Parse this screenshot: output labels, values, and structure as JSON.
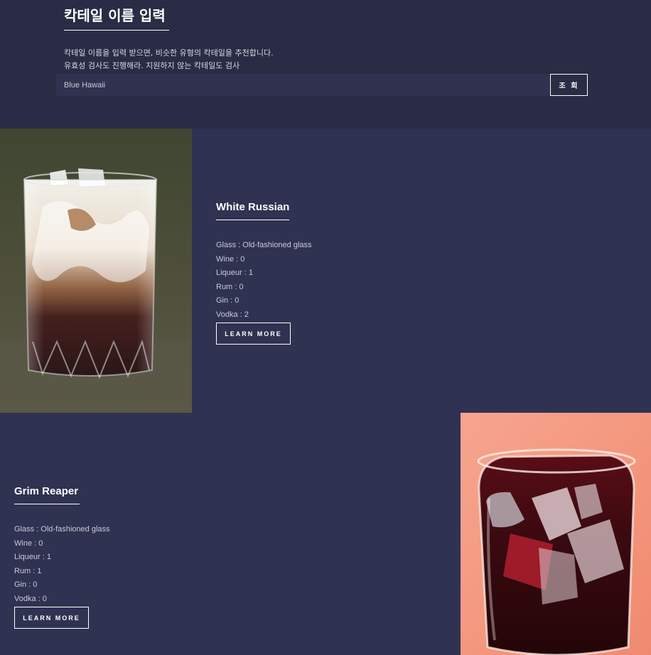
{
  "header": {
    "title": "칵테일 이름 입력",
    "desc_line1": "칵테일 이름을 입력 받으면, 비슷한 유형의 칵테일을 추천합니다.",
    "desc_line2": "유효성 검사도 진행해라. 지원하지 않는 칵테일도 검사"
  },
  "search": {
    "value": "Blue Hawaii",
    "button_label": "조 회"
  },
  "cocktails": [
    {
      "name": "White Russian",
      "specs": [
        "Glass : Old-fashioned glass",
        "Wine : 0",
        "Liqueur : 1",
        "Rum : 0",
        "Gin : 0",
        "Vodka : 2"
      ],
      "button_label": "LEARN MORE"
    },
    {
      "name": "Grim Reaper",
      "specs": [
        "Glass : Old-fashioned glass",
        "Wine : 0",
        "Liqueur : 1",
        "Rum : 1",
        "Gin : 0",
        "Vodka : 0"
      ],
      "button_label": "LEARN MORE"
    }
  ],
  "colors": {
    "page_bg": "#2a2c45",
    "card_bg": "#303252",
    "input_bg": "#30324f"
  }
}
